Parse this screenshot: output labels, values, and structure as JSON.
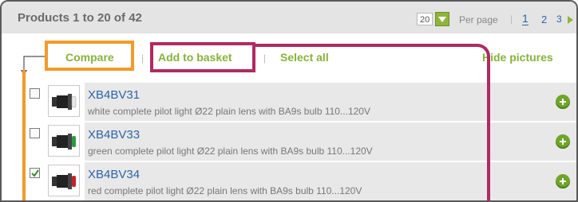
{
  "header": {
    "title": "Products 1 to 20 of 42",
    "per_page_value": "20",
    "per_page_label": "Per page",
    "separator": "|",
    "pages": [
      "1",
      "2",
      "3"
    ]
  },
  "actions": {
    "compare": "Compare",
    "add_to_basket": "Add to basket",
    "select_all": "Select all",
    "hide_pictures": "Hide pictures",
    "separator": "|"
  },
  "products": [
    {
      "code": "XB4BV31",
      "description": "white complete pilot light Ø22 plain lens with BA9s bulb 110...120V",
      "checked": false,
      "lens_color": "#e8e8e8"
    },
    {
      "code": "XB4BV33",
      "description": "green complete pilot light Ø22 plain lens with BA9s bulb 110...120V",
      "checked": false,
      "lens_color": "#2e9a3e"
    },
    {
      "code": "XB4BV34",
      "description": "red complete pilot light Ø22 plain lens with BA9s bulb 110...120V",
      "checked": true,
      "lens_color": "#c8202a"
    }
  ],
  "colors": {
    "accent_green": "#86b23a",
    "link_blue": "#2d64a8",
    "highlight_orange": "#f39a2a",
    "highlight_magenta": "#b02a62"
  }
}
